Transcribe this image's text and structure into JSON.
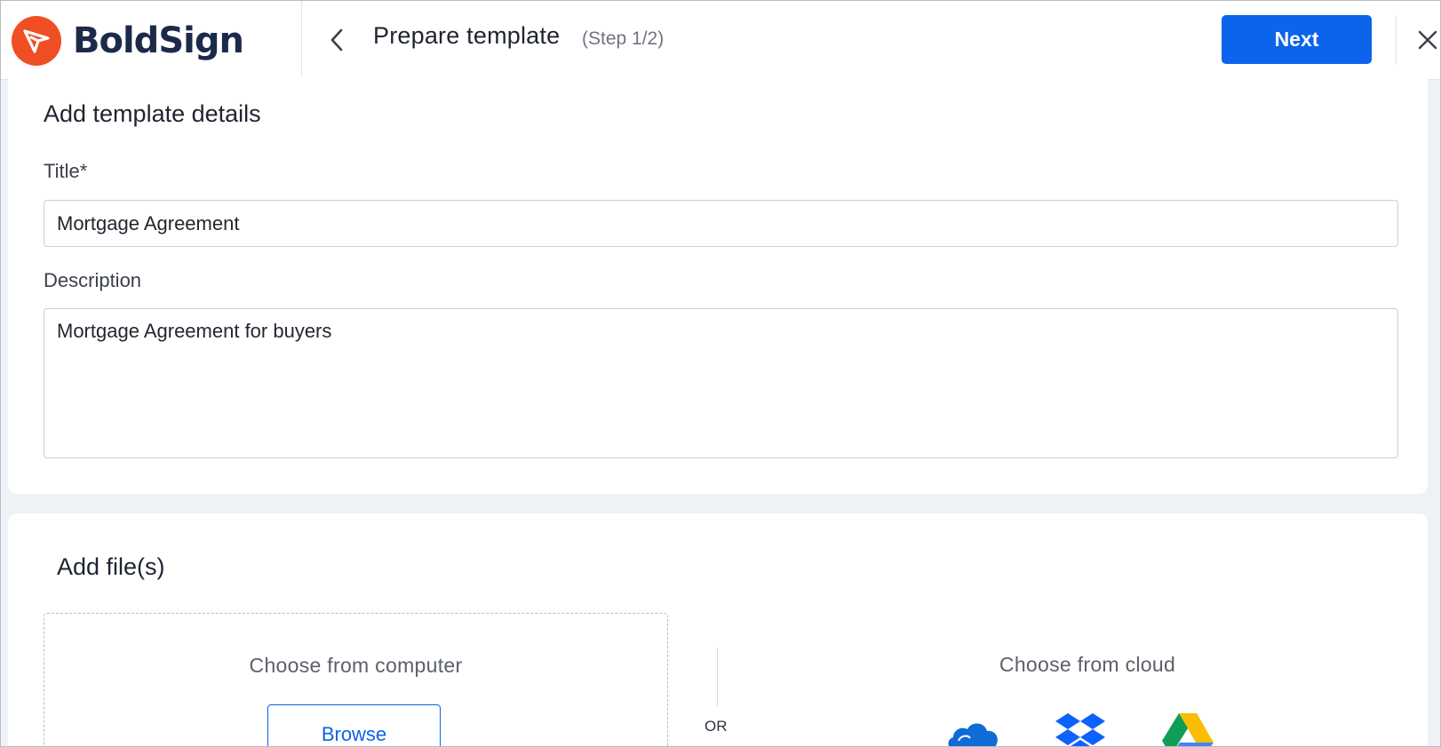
{
  "header": {
    "brand": "BoldSign",
    "title": "Prepare template",
    "step": "(Step 1/2)",
    "next_label": "Next",
    "back_icon": "chevron-left-icon",
    "close_icon": "close-icon"
  },
  "details": {
    "heading": "Add template details",
    "title_label": "Title*",
    "title_value": "Mortgage Agreement",
    "description_label": "Description",
    "description_value": "Mortgage Agreement for buyers"
  },
  "files": {
    "heading": "Add file(s)",
    "computer_label": "Choose from computer",
    "browse_label": "Browse",
    "or_label": "OR",
    "cloud_label": "Choose from cloud",
    "cloud_providers": [
      "onedrive-icon",
      "dropbox-icon",
      "google-drive-icon"
    ]
  },
  "colors": {
    "brand_orange": "#f04e23",
    "brand_navy": "#1c2a4a",
    "primary_blue": "#0b64ea",
    "page_bg": "#eef2f7"
  }
}
